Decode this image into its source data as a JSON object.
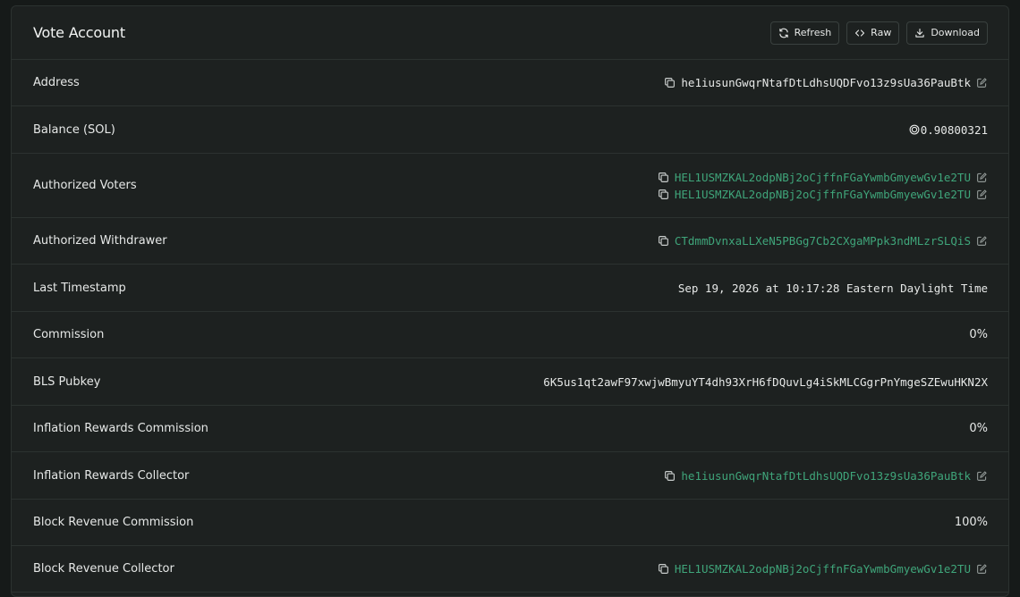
{
  "header": {
    "title": "Vote Account",
    "buttons": [
      {
        "label": "Refresh",
        "icon": "refresh-icon"
      },
      {
        "label": "Raw",
        "icon": "code-icon"
      },
      {
        "label": "Download",
        "icon": "download-icon"
      }
    ]
  },
  "rows": {
    "address": {
      "label": "Address",
      "value": "he1iusunGwqrNtafDtLdhsUQDFvo13z9sUa36PauBtk"
    },
    "balance": {
      "label": "Balance (SOL)",
      "value": "0.90800321"
    },
    "authorized_voters": {
      "label": "Authorized Voters",
      "values": [
        "HEL1USMZKAL2odpNBj2oCjffnFGaYwmbGmyewGv1e2TU",
        "HEL1USMZKAL2odpNBj2oCjffnFGaYwmbGmyewGv1e2TU"
      ]
    },
    "authorized_withdrawer": {
      "label": "Authorized Withdrawer",
      "value": "CTdmmDvnxaLLXeN5PBGg7Cb2CXgaMPpk3ndMLzrSLQiS"
    },
    "last_timestamp": {
      "label": "Last Timestamp",
      "value": "Sep 19, 2026 at 10:17:28 Eastern Daylight Time"
    },
    "commission": {
      "label": "Commission",
      "value": "0%"
    },
    "bls_pubkey": {
      "label": "BLS Pubkey",
      "value": "6K5us1qt2awF97xwjwBmyuYT4dh93XrH6fDQuvLg4iSkMLCGgrPnYmgeSZEwuHKN2X"
    },
    "inflation_rewards_commission": {
      "label": "Inflation Rewards Commission",
      "value": "0%"
    },
    "inflation_rewards_collector": {
      "label": "Inflation Rewards Collector",
      "value": "he1iusunGwqrNtafDtLdhsUQDFvo13z9sUa36PauBtk"
    },
    "block_revenue_commission": {
      "label": "Block Revenue Commission",
      "value": "100%"
    },
    "block_revenue_collector": {
      "label": "Block Revenue Collector",
      "value": "HEL1USMZKAL2odpNBj2oCjffnFGaYwmbGmyewGv1e2TU"
    }
  },
  "colors": {
    "link": "#3fa57a",
    "background": "#161a19",
    "card": "#1d2120",
    "border": "#2c3230"
  }
}
